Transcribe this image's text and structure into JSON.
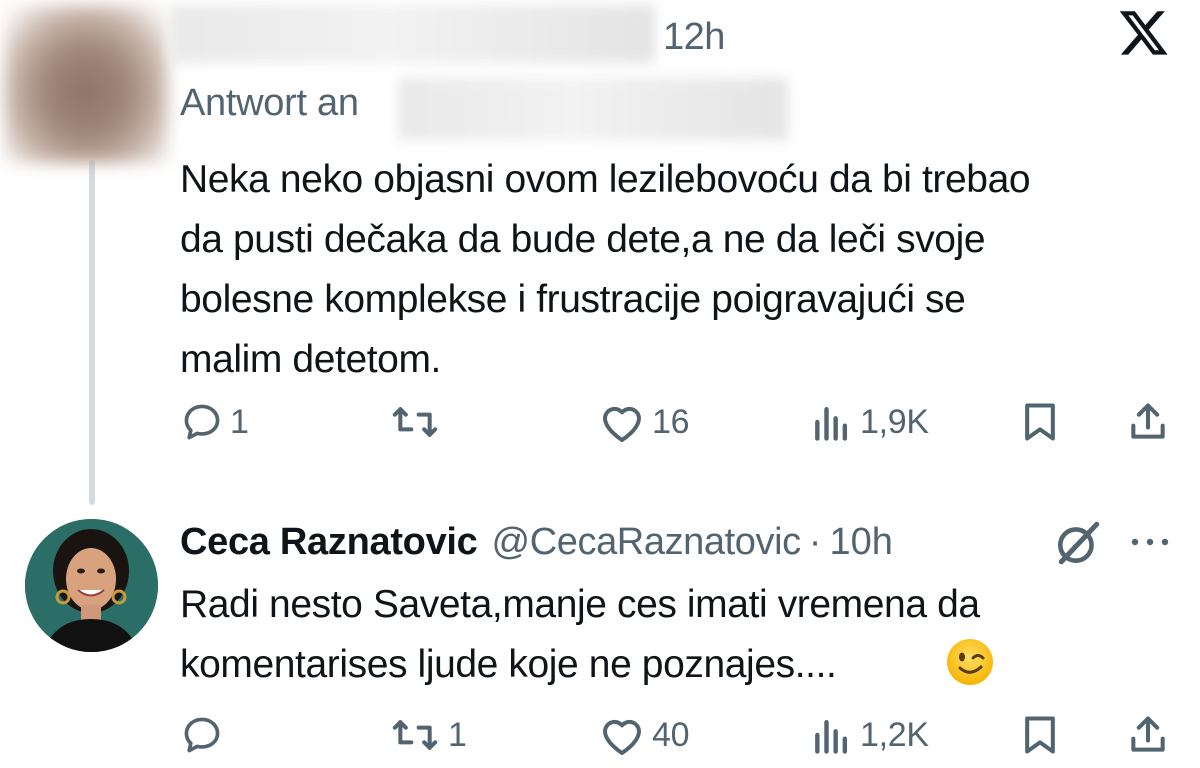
{
  "tweet1": {
    "time": "12h",
    "reply_prefix": "Antwort an",
    "text": "Neka neko objasni ovom lezilebovoću da bi trebao\nda pusti dečaka da bude dete,a ne da leči svoje\nbolesne komplekse i frustracije poigravajući se\nmalim detetom.",
    "actions": {
      "replies": "1",
      "reposts": "",
      "likes": "16",
      "views": "1,9K"
    }
  },
  "tweet2": {
    "author_name": "Ceca Raznatovic",
    "author_handle": "@CecaRaznatovic",
    "separator": "·",
    "time": "10h",
    "text": "Radi nesto Saveta,manje ces imati vremena da\nkomentarises ljude koje ne poznajes....",
    "emoji": "wink-emoji",
    "actions": {
      "replies": "",
      "reposts": "1",
      "likes": "40",
      "views": "1,2K"
    }
  },
  "icons": {
    "reply": "reply-icon",
    "repost": "repost-icon",
    "like": "heart-icon",
    "views": "views-icon",
    "bookmark": "bookmark-icon",
    "share": "share-icon",
    "logo": "x-logo-icon",
    "grok": "grok-icon",
    "more": "more-icon"
  },
  "colors": {
    "text": "#0f1419",
    "muted": "#536471",
    "thread_line": "#d6dbdf"
  }
}
